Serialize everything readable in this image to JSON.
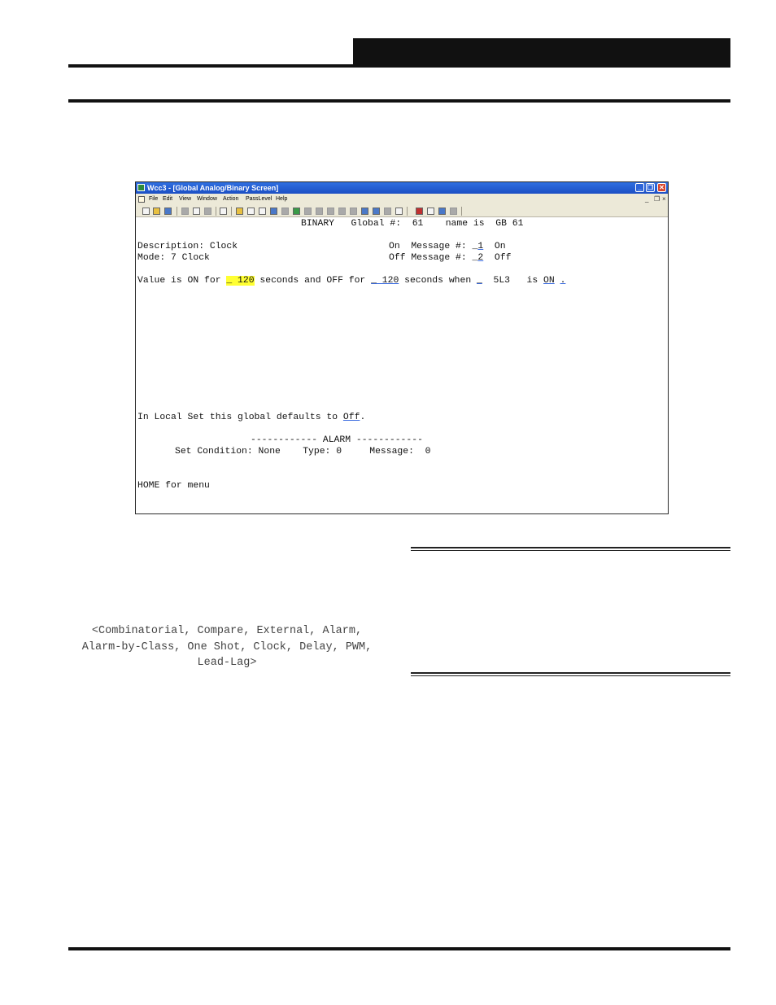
{
  "window": {
    "title": "Wcc3 - [Global Analog/Binary Screen]",
    "controls": {
      "minimize": "_",
      "restore": "❐",
      "close": "✕"
    }
  },
  "menubar": {
    "items": [
      "File",
      "Edit",
      "View",
      "Window",
      "Action",
      "PassLevel",
      "Help"
    ],
    "mdi_controls": [
      "_",
      "❐",
      "×"
    ]
  },
  "screen": {
    "header": "BINARY   Global #:  61    name is  GB 61",
    "description_line": "Description: Clock",
    "mode_line": "Mode: 7 Clock",
    "on_message": {
      "prefix": "On  Message #: ",
      "underscore": "_",
      "number": "1",
      "text": "On"
    },
    "off_message": {
      "prefix": "Off Message #: ",
      "underscore": "_",
      "number": "2",
      "text": "Off"
    },
    "value_line": {
      "t1": "Value is ON for ",
      "on_field": "_ 120",
      "t2": " seconds and OFF for ",
      "off_field": "_ 120",
      "t3": " seconds when ",
      "when_field": "_",
      "t4": "  5L3   is ",
      "state_field": "ON",
      "t5": " ",
      "end_field": "."
    },
    "local_set": {
      "t1": "In Local Set this global defaults to ",
      "value": "Off",
      "t2": "."
    },
    "alarm_header": "------------ ALARM ------------",
    "alarm_detail": "Set Condition: None    Type: 0     Message:  0",
    "home_line": "HOME for menu"
  },
  "mode_options": {
    "line1": "<Combinatorial, Compare, External, Alarm,",
    "line2": "Alarm-by-Class, One Shot, Clock, Delay, PWM,",
    "line3": "Lead-Lag>"
  },
  "toolbar_icons": [
    "new-icon",
    "open-icon",
    "save-icon",
    "cut-icon",
    "copy-icon",
    "paste-icon",
    "print-icon",
    "help-icon",
    "print-screen-icon",
    "print-all-icon",
    "forward-icon",
    "back-icon",
    "check-icon",
    "bell-icon",
    "alarm-icon",
    "filter-icon",
    "star-icon",
    "tools-icon",
    "network-icon",
    "refresh-icon",
    "globe-icon",
    "blank-icon",
    "color-icon",
    "monitor-icon",
    "graph-icon",
    "tree-icon"
  ]
}
